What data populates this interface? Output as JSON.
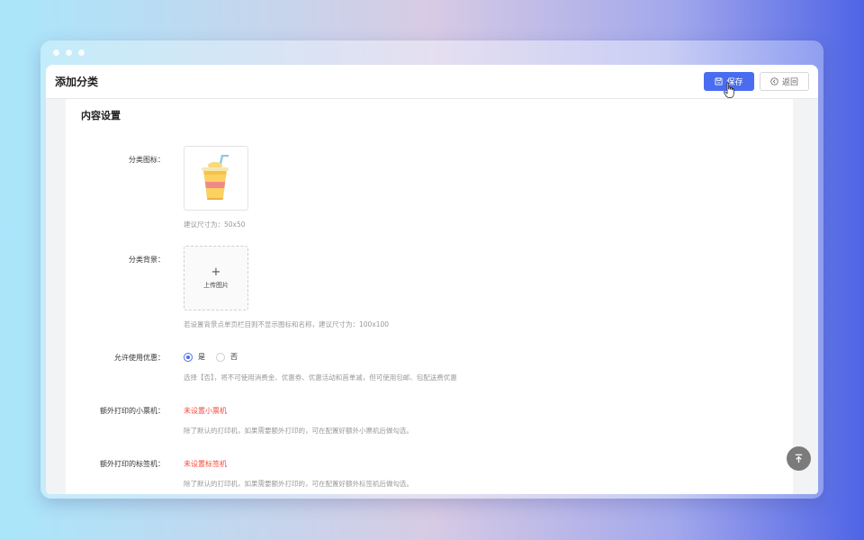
{
  "header": {
    "title": "添加分类",
    "save_label": "保存",
    "back_label": "返回"
  },
  "section": {
    "title": "内容设置"
  },
  "form": {
    "icon": {
      "label": "分类图标：",
      "hint": "建议尺寸为：50x50"
    },
    "background": {
      "label": "分类背景：",
      "upload_label": "上传图片",
      "hint": "若设置背景点单页栏目则不显示图标和名称，建议尺寸为：100x100"
    },
    "discount": {
      "label": "允许使用优惠：",
      "options": [
        "是",
        "否"
      ],
      "selected": "是",
      "hint": "选择【否】，将不可使用消费金、优惠券、优惠活动和首单减，但可使用包邮、包配送费优惠"
    },
    "receipt_printer": {
      "label": "额外打印的小票机：",
      "link": "未设置小票机",
      "hint": "除了默认的打印机，如果需要额外打印的，可在配置好额外小票机后做勾选。"
    },
    "label_printer": {
      "label": "额外打印的标签机：",
      "link": "未设置标签机",
      "hint": "除了默认的打印机，如果需要额外打印的，可在配置好额外标签机后做勾选。"
    }
  },
  "colors": {
    "primary": "#4a6cf0",
    "danger": "#f5483b",
    "hint": "#999999"
  },
  "icons": {
    "save": "save-icon",
    "back": "circle-back-icon",
    "back_top": "back-to-top-icon",
    "category": "drink-cup-icon"
  }
}
